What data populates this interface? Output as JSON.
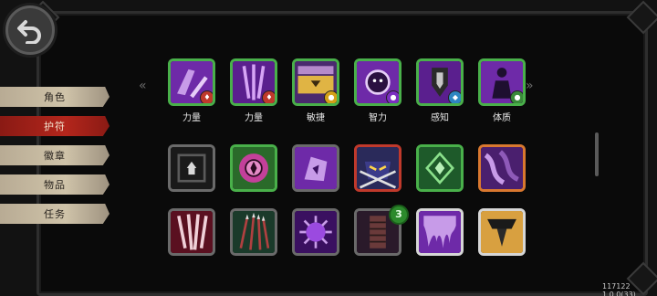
{
  "navigation": {
    "back_icon": "back-arrow-icon",
    "tabs": [
      {
        "label": "角色",
        "active": false
      },
      {
        "label": "护符",
        "active": true
      },
      {
        "label": "徽章",
        "active": false
      },
      {
        "label": "物品",
        "active": false
      },
      {
        "label": "任务",
        "active": false
      }
    ]
  },
  "paging": {
    "left": "«",
    "right": "»"
  },
  "stats_row": [
    {
      "label": "力量",
      "icon": "strength-claw-icon",
      "border": "green",
      "mini": "red"
    },
    {
      "label": "力量",
      "icon": "strength-bolt-icon",
      "border": "green",
      "mini": "red"
    },
    {
      "label": "敏捷",
      "icon": "dexterity-chest-icon",
      "border": "green",
      "mini": "yellow"
    },
    {
      "label": "智力",
      "icon": "intellect-orb-icon",
      "border": "green",
      "mini": "purple"
    },
    {
      "label": "感知",
      "icon": "perception-crystal-icon",
      "border": "green",
      "mini": "blue"
    },
    {
      "label": "体质",
      "icon": "constitution-figure-icon",
      "border": "green",
      "mini": "green"
    }
  ],
  "row2": [
    {
      "icon": "dark-chest-icon",
      "border": "gray"
    },
    {
      "icon": "pink-sigil-icon",
      "border": "green"
    },
    {
      "icon": "purple-rune-icon",
      "border": "gray"
    },
    {
      "icon": "masked-face-icon",
      "border": "red"
    },
    {
      "icon": "green-diamond-icon",
      "border": "green"
    },
    {
      "icon": "purple-wave-icon",
      "border": "orange"
    }
  ],
  "row3": [
    {
      "icon": "claw-marks-icon",
      "border": "gray"
    },
    {
      "icon": "spear-bundle-icon",
      "border": "gray"
    },
    {
      "icon": "spiky-orb-icon",
      "border": "gray"
    },
    {
      "icon": "cloth-bundle-icon",
      "border": "gray",
      "count": "3"
    },
    {
      "icon": "dripping-slime-icon",
      "border": "white"
    },
    {
      "icon": "dark-chandelier-icon",
      "border": "white"
    }
  ],
  "version": "117122 1.0.0(33)",
  "colors": {
    "accent_red": "#b3261c",
    "border_green": "#49b04a",
    "icon_purple": "#7b2fc0"
  }
}
